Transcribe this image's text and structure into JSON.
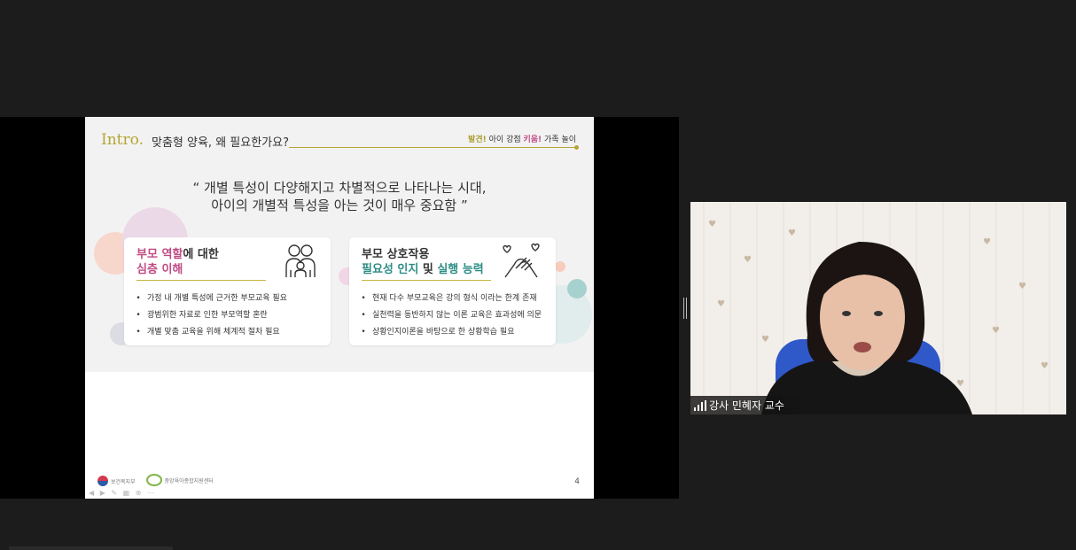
{
  "slide": {
    "intro_word": "Intro",
    "intro_dot": ".",
    "title": "맞춤형 양육, 왜 필요한가요?",
    "tagline": {
      "part1": "발견!",
      "part2": " 아이 강점 ",
      "part3": "키움!",
      "part4": " 가족 놀이"
    },
    "quote_line1": "“ 개별 특성이 다양해지고 차별적으로 나타나는 시대,",
    "quote_line2": "아이의 개별적 특성을 아는 것이 매우 중요함 ”",
    "cards": [
      {
        "title_a": "부모 역할",
        "title_b": "에 대한",
        "title_c": "심층 이해",
        "items": [
          "가정 내 개별 특성에 근거한 부모교육 필요",
          "광범위한 자료로 인한 부모역할 혼란",
          "개별 맞춤 교육을 위해 체계적 절차 필요"
        ],
        "icon": "family-icon"
      },
      {
        "title_a": "부모 상호작용",
        "title_b": "필요성 인지",
        "title_c": " 및 ",
        "title_d": "실행 능력",
        "items": [
          "현재 다수 부모교육은 강의 형식 이라는 한계 존재",
          "실천력을 동반하지 않는 이론 교육은 효과성에 의문",
          "상황인지이론을 바탕으로 한 상황학습 필요"
        ],
        "icon": "holding-hands-icon"
      }
    ],
    "footer": {
      "logo1": "보건복지부",
      "logo2": "중앙육아종합지원센터"
    },
    "page_number": "4",
    "accent_colors": {
      "olive": "#b4a634",
      "pink": "#c04b84",
      "teal": "#2f8d86"
    }
  },
  "video": {
    "speaker_name": "강사 민혜자 교수",
    "signal_icon": "signal-bars-icon"
  }
}
